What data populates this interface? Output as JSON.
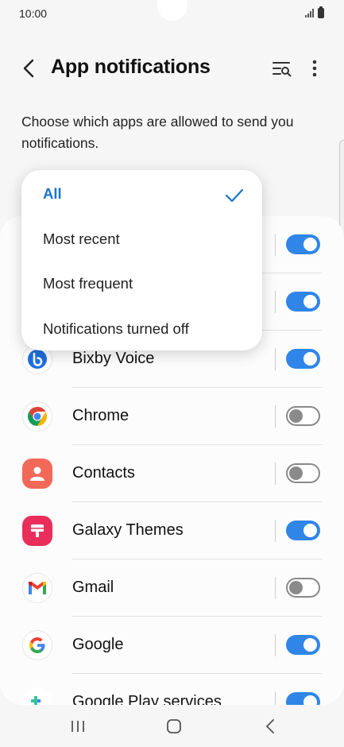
{
  "status": {
    "time": "10:00"
  },
  "header": {
    "title": "App notifications"
  },
  "description": "Choose which apps are allowed to send you notifications.",
  "dropdown": {
    "options": [
      "All",
      "Most recent",
      "Most frequent",
      "Notifications turned off"
    ],
    "selected": "All"
  },
  "apps": [
    {
      "name": "",
      "enabled": true
    },
    {
      "name": "",
      "enabled": true
    },
    {
      "name": "Bixby Voice",
      "enabled": true,
      "icon": "bixby-voice-icon"
    },
    {
      "name": "Chrome",
      "enabled": false,
      "icon": "chrome-icon"
    },
    {
      "name": "Contacts",
      "enabled": false,
      "icon": "contacts-icon"
    },
    {
      "name": "Galaxy Themes",
      "enabled": true,
      "icon": "galaxy-themes-icon"
    },
    {
      "name": "Gmail",
      "enabled": false,
      "icon": "gmail-icon"
    },
    {
      "name": "Google",
      "enabled": true,
      "icon": "google-icon"
    },
    {
      "name": "Google Play services",
      "enabled": true,
      "icon": "google-play-services-icon"
    }
  ],
  "colors": {
    "accent": "#2f86e8",
    "selected_text": "#1a73c9",
    "toggle_off": "#8a8a8a"
  }
}
